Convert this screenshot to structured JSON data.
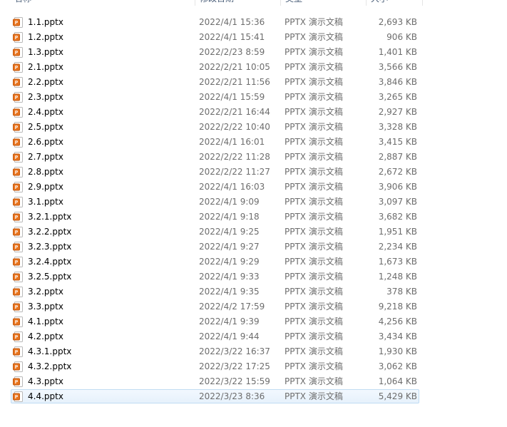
{
  "columns": {
    "name": "名称",
    "date": "修改日期",
    "type": "类型",
    "size": "大小"
  },
  "colors": {
    "pptx_icon": "#e8741e",
    "selection_border": "#c0dcf3",
    "selection_fill": "#e8f2fd"
  },
  "files": [
    {
      "name": "1.1.pptx",
      "date": "2022/4/1 15:36",
      "type": "PPTX 演示文稿",
      "size": "2,693 KB",
      "icon": "pptx-icon"
    },
    {
      "name": "1.2.pptx",
      "date": "2022/4/1 15:41",
      "type": "PPTX 演示文稿",
      "size": "906 KB",
      "icon": "pptx-icon"
    },
    {
      "name": "1.3.pptx",
      "date": "2022/2/23 8:59",
      "type": "PPTX 演示文稿",
      "size": "1,401 KB",
      "icon": "pptx-icon"
    },
    {
      "name": "2.1.pptx",
      "date": "2022/2/21 10:05",
      "type": "PPTX 演示文稿",
      "size": "3,566 KB",
      "icon": "pptx-icon"
    },
    {
      "name": "2.2.pptx",
      "date": "2022/2/21 11:56",
      "type": "PPTX 演示文稿",
      "size": "3,846 KB",
      "icon": "pptx-icon"
    },
    {
      "name": "2.3.pptx",
      "date": "2022/4/1 15:59",
      "type": "PPTX 演示文稿",
      "size": "3,265 KB",
      "icon": "pptx-icon"
    },
    {
      "name": "2.4.pptx",
      "date": "2022/2/21 16:44",
      "type": "PPTX 演示文稿",
      "size": "2,927 KB",
      "icon": "pptx-icon"
    },
    {
      "name": "2.5.pptx",
      "date": "2022/2/22 10:40",
      "type": "PPTX 演示文稿",
      "size": "3,328 KB",
      "icon": "pptx-icon"
    },
    {
      "name": "2.6.pptx",
      "date": "2022/4/1 16:01",
      "type": "PPTX 演示文稿",
      "size": "3,415 KB",
      "icon": "pptx-icon"
    },
    {
      "name": "2.7.pptx",
      "date": "2022/2/22 11:28",
      "type": "PPTX 演示文稿",
      "size": "2,887 KB",
      "icon": "pptx-icon"
    },
    {
      "name": "2.8.pptx",
      "date": "2022/2/22 11:27",
      "type": "PPTX 演示文稿",
      "size": "2,672 KB",
      "icon": "pptx-icon"
    },
    {
      "name": "2.9.pptx",
      "date": "2022/4/1 16:03",
      "type": "PPTX 演示文稿",
      "size": "3,906 KB",
      "icon": "pptx-icon"
    },
    {
      "name": "3.1.pptx",
      "date": "2022/4/1 9:09",
      "type": "PPTX 演示文稿",
      "size": "3,097 KB",
      "icon": "pptx-icon"
    },
    {
      "name": "3.2.1.pptx",
      "date": "2022/4/1 9:18",
      "type": "PPTX 演示文稿",
      "size": "3,682 KB",
      "icon": "pptx-icon"
    },
    {
      "name": "3.2.2.pptx",
      "date": "2022/4/1 9:25",
      "type": "PPTX 演示文稿",
      "size": "1,951 KB",
      "icon": "pptx-icon"
    },
    {
      "name": "3.2.3.pptx",
      "date": "2022/4/1 9:27",
      "type": "PPTX 演示文稿",
      "size": "2,234 KB",
      "icon": "pptx-icon"
    },
    {
      "name": "3.2.4.pptx",
      "date": "2022/4/1 9:29",
      "type": "PPTX 演示文稿",
      "size": "1,673 KB",
      "icon": "pptx-icon"
    },
    {
      "name": "3.2.5.pptx",
      "date": "2022/4/1 9:33",
      "type": "PPTX 演示文稿",
      "size": "1,248 KB",
      "icon": "pptx-icon"
    },
    {
      "name": "3.2.pptx",
      "date": "2022/4/1 9:35",
      "type": "PPTX 演示文稿",
      "size": "378 KB",
      "icon": "pptx-icon"
    },
    {
      "name": "3.3.pptx",
      "date": "2022/4/2 17:59",
      "type": "PPTX 演示文稿",
      "size": "9,218 KB",
      "icon": "pptx-icon"
    },
    {
      "name": "4.1.pptx",
      "date": "2022/4/1 9:39",
      "type": "PPTX 演示文稿",
      "size": "4,256 KB",
      "icon": "pptx-icon"
    },
    {
      "name": "4.2.pptx",
      "date": "2022/4/1 9:44",
      "type": "PPTX 演示文稿",
      "size": "3,434 KB",
      "icon": "pptx-icon"
    },
    {
      "name": "4.3.1.pptx",
      "date": "2022/3/22 16:37",
      "type": "PPTX 演示文稿",
      "size": "1,930 KB",
      "icon": "pptx-icon"
    },
    {
      "name": "4.3.2.pptx",
      "date": "2022/3/22 17:25",
      "type": "PPTX 演示文稿",
      "size": "3,062 KB",
      "icon": "pptx-icon"
    },
    {
      "name": "4.3.pptx",
      "date": "2022/3/22 15:59",
      "type": "PPTX 演示文稿",
      "size": "1,064 KB",
      "icon": "pptx-icon"
    },
    {
      "name": "4.4.pptx",
      "date": "2022/3/23 8:36",
      "type": "PPTX 演示文稿",
      "size": "5,429 KB",
      "icon": "pptx-icon",
      "selected": true
    }
  ]
}
